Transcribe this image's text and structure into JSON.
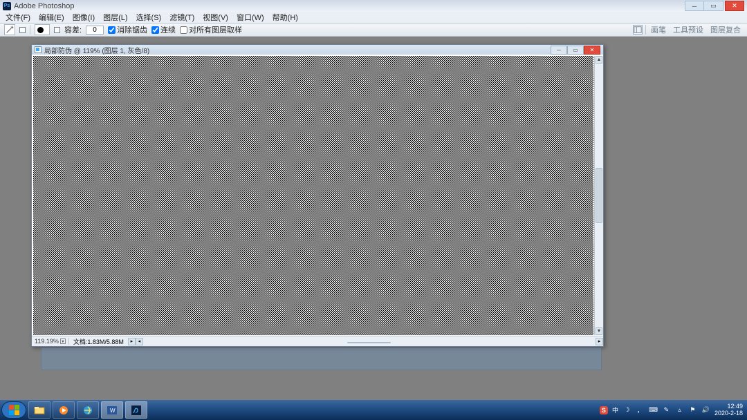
{
  "app": {
    "title": "Adobe Photoshop"
  },
  "menus": {
    "file": "文件(F)",
    "edit": "编辑(E)",
    "image": "图像(I)",
    "layer": "图层(L)",
    "select": "选择(S)",
    "filter": "滤镜(T)",
    "view": "视图(V)",
    "window": "窗口(W)",
    "help": "帮助(H)"
  },
  "options": {
    "tolerance_label": "容差:",
    "tolerance_value": "0",
    "antialias": "消除锯齿",
    "contiguous": "连续",
    "all_layers": "对所有图层取样",
    "right_tabs": [
      "画笔",
      "工具预设",
      "图层复合"
    ]
  },
  "document": {
    "title": "局部防伪 @ 119% (图层 1, 灰色/8)",
    "zoom": "119.19%",
    "status": "文档:1.83M/5.88M"
  },
  "taskbar": {
    "ime_badge": "S",
    "ime_text": "中",
    "time": "12:49",
    "date": "2020-2-18"
  }
}
